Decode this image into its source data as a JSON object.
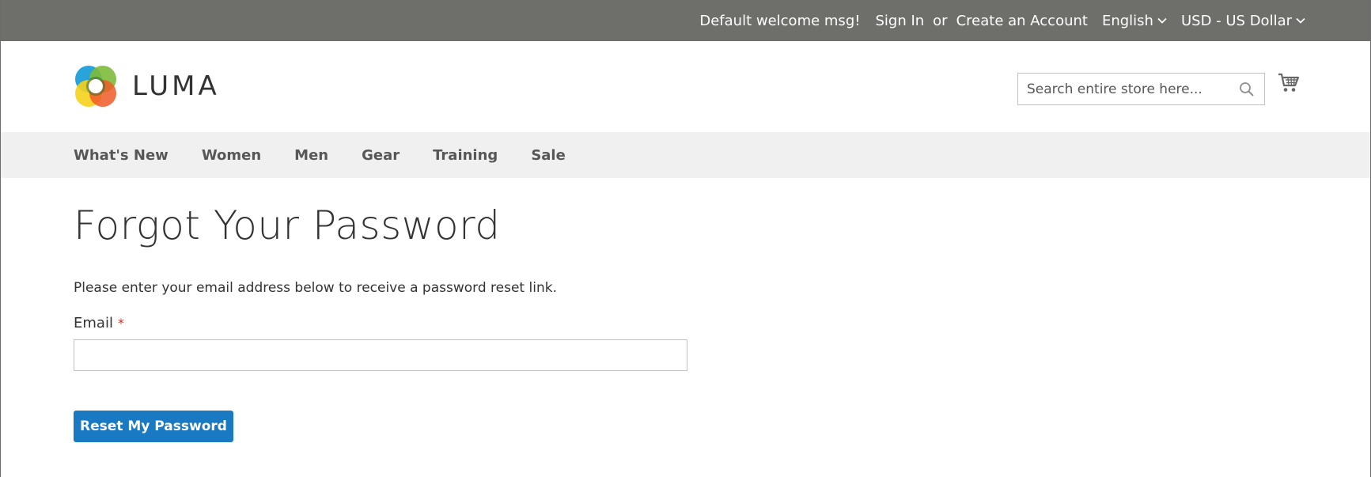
{
  "topbar": {
    "welcome": "Default welcome msg!",
    "sign_in": "Sign In",
    "or": "or",
    "create_account": "Create an Account",
    "language": "English",
    "currency": "USD - US Dollar",
    "background": "#6e6e6b"
  },
  "header": {
    "logo_text": "LUMA",
    "search_placeholder": "Search entire store here..."
  },
  "nav": {
    "items": [
      "What's New",
      "Women",
      "Men",
      "Gear",
      "Training",
      "Sale"
    ]
  },
  "main": {
    "title": "Forgot Your Password",
    "note": "Please enter your email address below to receive a password reset link.",
    "email_label": "Email",
    "required_marker": "*",
    "email_value": "",
    "button_label": "Reset My Password",
    "button_color": "#1979c3"
  },
  "icons": {
    "search": "search-icon",
    "cart": "cart-icon",
    "chevron": "chevron-down-icon"
  }
}
